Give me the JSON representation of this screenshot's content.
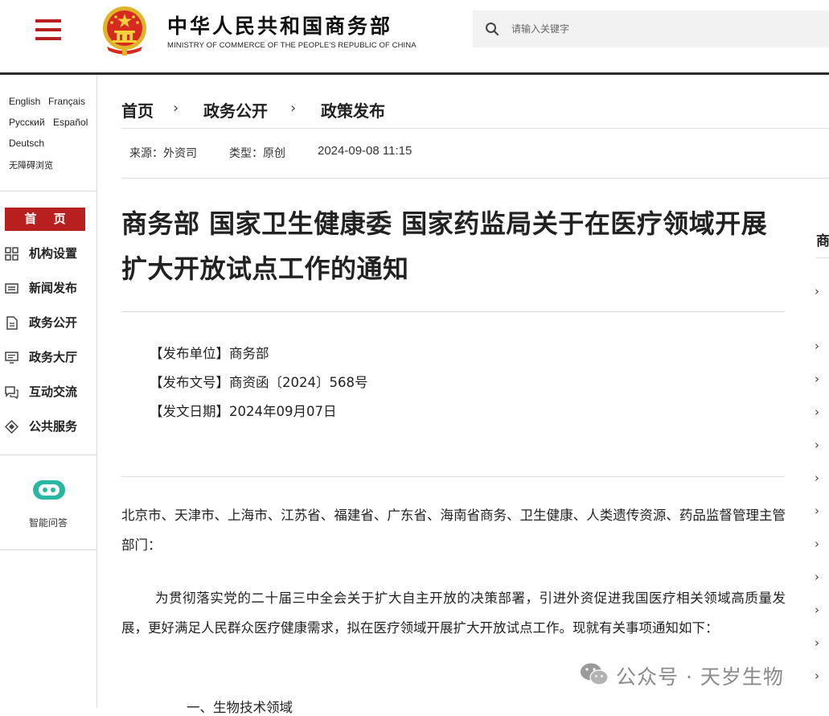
{
  "header": {
    "title": "中华人民共和国商务部",
    "subtitle": "MINISTRY OF COMMERCE OF THE PEOPLE'S REPUBLIC OF CHINA",
    "search_placeholder": "请输入关键字",
    "accent_color": "#b8201f"
  },
  "sidebar": {
    "languages": [
      "English",
      "Français",
      "Русский",
      "Español",
      "Deutsch"
    ],
    "accessibility": "无障碍浏览",
    "home": "首 页",
    "nav": [
      {
        "label": "机构设置",
        "icon": "grid-icon"
      },
      {
        "label": "新闻发布",
        "icon": "news-icon"
      },
      {
        "label": "政务公开",
        "icon": "document-icon"
      },
      {
        "label": "政务大厅",
        "icon": "monitor-icon"
      },
      {
        "label": "互动交流",
        "icon": "chat-icon"
      },
      {
        "label": "公共服务",
        "icon": "service-icon"
      }
    ],
    "assistant": "智能问答"
  },
  "breadcrumb": [
    "首页",
    "政务公开",
    "政策发布"
  ],
  "meta": {
    "source": "来源：外资司",
    "type": "类型：原创",
    "datetime": "2024-09-08 11:15"
  },
  "article": {
    "title": "商务部 国家卫生健康委 国家药监局关于在医疗领域开展扩大开放试点工作的通知",
    "issuer": "【发布单位】商务部",
    "doc_number": "【发布文号】商资函〔2024〕568号",
    "issue_date": "【发文日期】2024年09月07日",
    "addressee": "北京市、天津市、上海市、江苏省、福建省、广东省、海南省商务、卫生健康、人类遗传资源、药品监督管理主管部门：",
    "body": "为贯彻落实党的二十届三中全会关于扩大自主开放的决策部署，引进外资促进我国医疗相关领域高质量发展，更好满足人民群众医疗健康需求，拟在医疗领域开展扩大开放试点工作。现就有关事项通知如下：",
    "section": "一、生物技术领域"
  },
  "right_column": {
    "heading": "商"
  },
  "watermark": {
    "text": "公众号 · 天岁生物"
  }
}
